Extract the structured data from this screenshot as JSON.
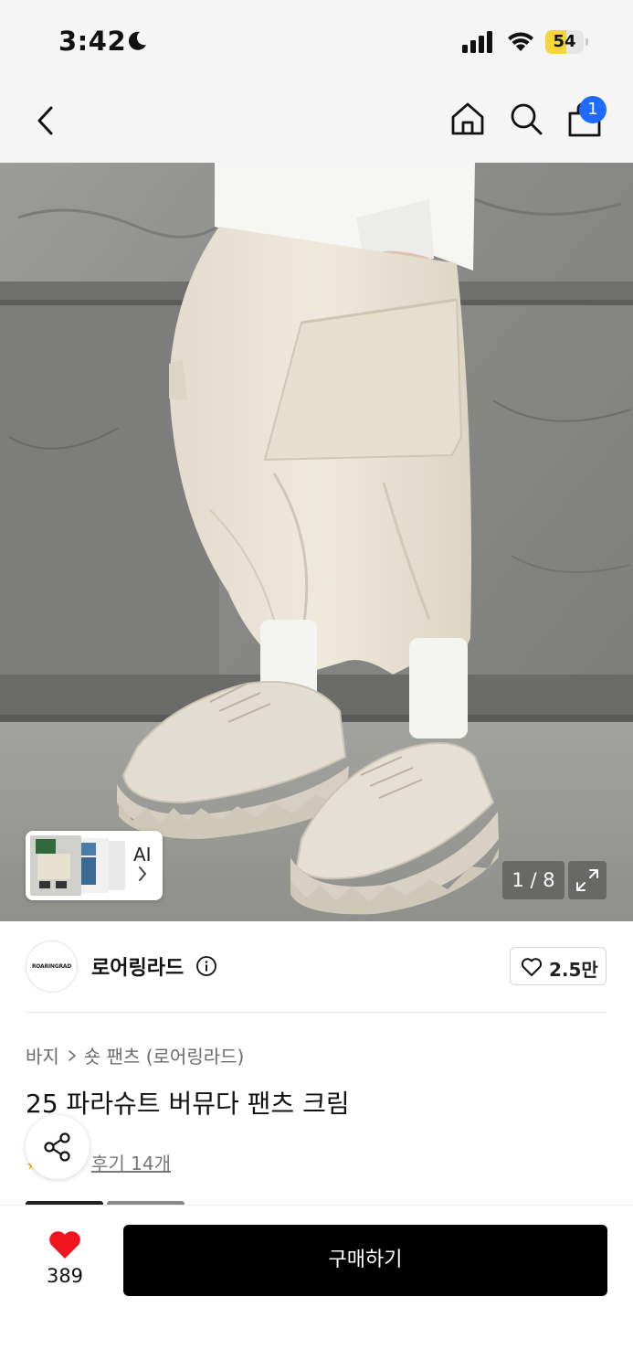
{
  "status_bar": {
    "time": "3:42",
    "battery_percent": 54
  },
  "nav": {
    "back_icon": "chevron-left-icon",
    "home_icon": "home-icon",
    "search_icon": "search-icon",
    "cart_icon": "shopping-bag-icon",
    "cart_badge": "1",
    "badge_color": "#1f6bff"
  },
  "gallery": {
    "ai_label": "AI",
    "counter": "1 / 8",
    "expand_icon": "expand-icon"
  },
  "brand": {
    "logo_text": "ROARINGRAD",
    "name": "로어링라드",
    "info_icon": "info-icon",
    "like_count": "2.5만"
  },
  "product": {
    "breadcrumb": [
      "바지",
      "숏 팬츠 (로어링라드)"
    ],
    "title": "25 파라슈트 버뮤다 팬츠 크림",
    "review_link": "후기 14개",
    "share_icon": "share-icon"
  },
  "bottom_bar": {
    "wish_count": "389",
    "wish_color": "#f0141e",
    "buy_label": "구매하기"
  }
}
